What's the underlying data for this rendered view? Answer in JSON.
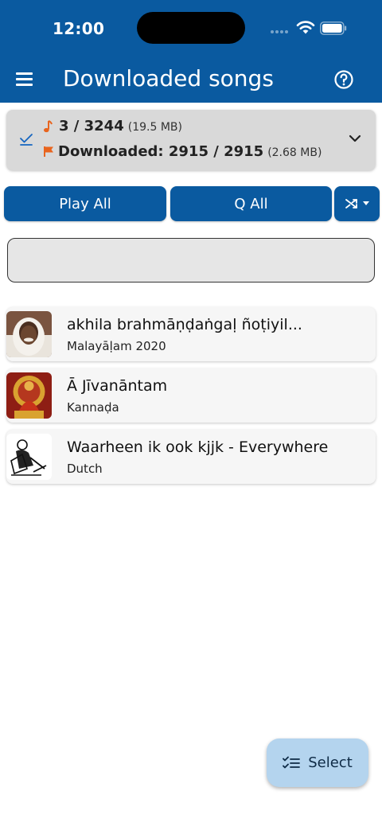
{
  "status_bar": {
    "time": "12:00",
    "icons": [
      "signal-icon",
      "wifi-icon",
      "battery-icon"
    ]
  },
  "app_bar": {
    "title": "Downloaded songs",
    "menu_icon": "menu-icon",
    "help_icon": "help-icon"
  },
  "summary": {
    "song_count": "3 / 3244",
    "song_size": "(19.5 MB)",
    "downloaded": "Downloaded: 2915 / 2915",
    "downloaded_size": "(2.68 MB)",
    "icons": [
      "check-icon",
      "music-note-icon",
      "flag-icon",
      "chevron-down-icon"
    ]
  },
  "actions": {
    "play_all": "Play All",
    "queue_all": "Q All",
    "shuffle_icon": "shuffle-icon"
  },
  "search": {
    "value": "",
    "placeholder": ""
  },
  "songs": [
    {
      "title": "akhila brahmāṇḍaṅgaḷ ñoṭiyil...",
      "language": "Malayāḷam 2020"
    },
    {
      "title": "Ā Jīvanāntam",
      "language": "Kannaḍa"
    },
    {
      "title": "Waarheen ik ook kjjk - Everywhere",
      "language": "Dutch"
    }
  ],
  "fab": {
    "label": "Select",
    "icon": "checklist-icon"
  },
  "colors": {
    "primary": "#0a5aa0",
    "summary_bg": "#d9d9d9",
    "accent_orange": "#e8641e",
    "fab_bg": "#b4d4ee"
  }
}
